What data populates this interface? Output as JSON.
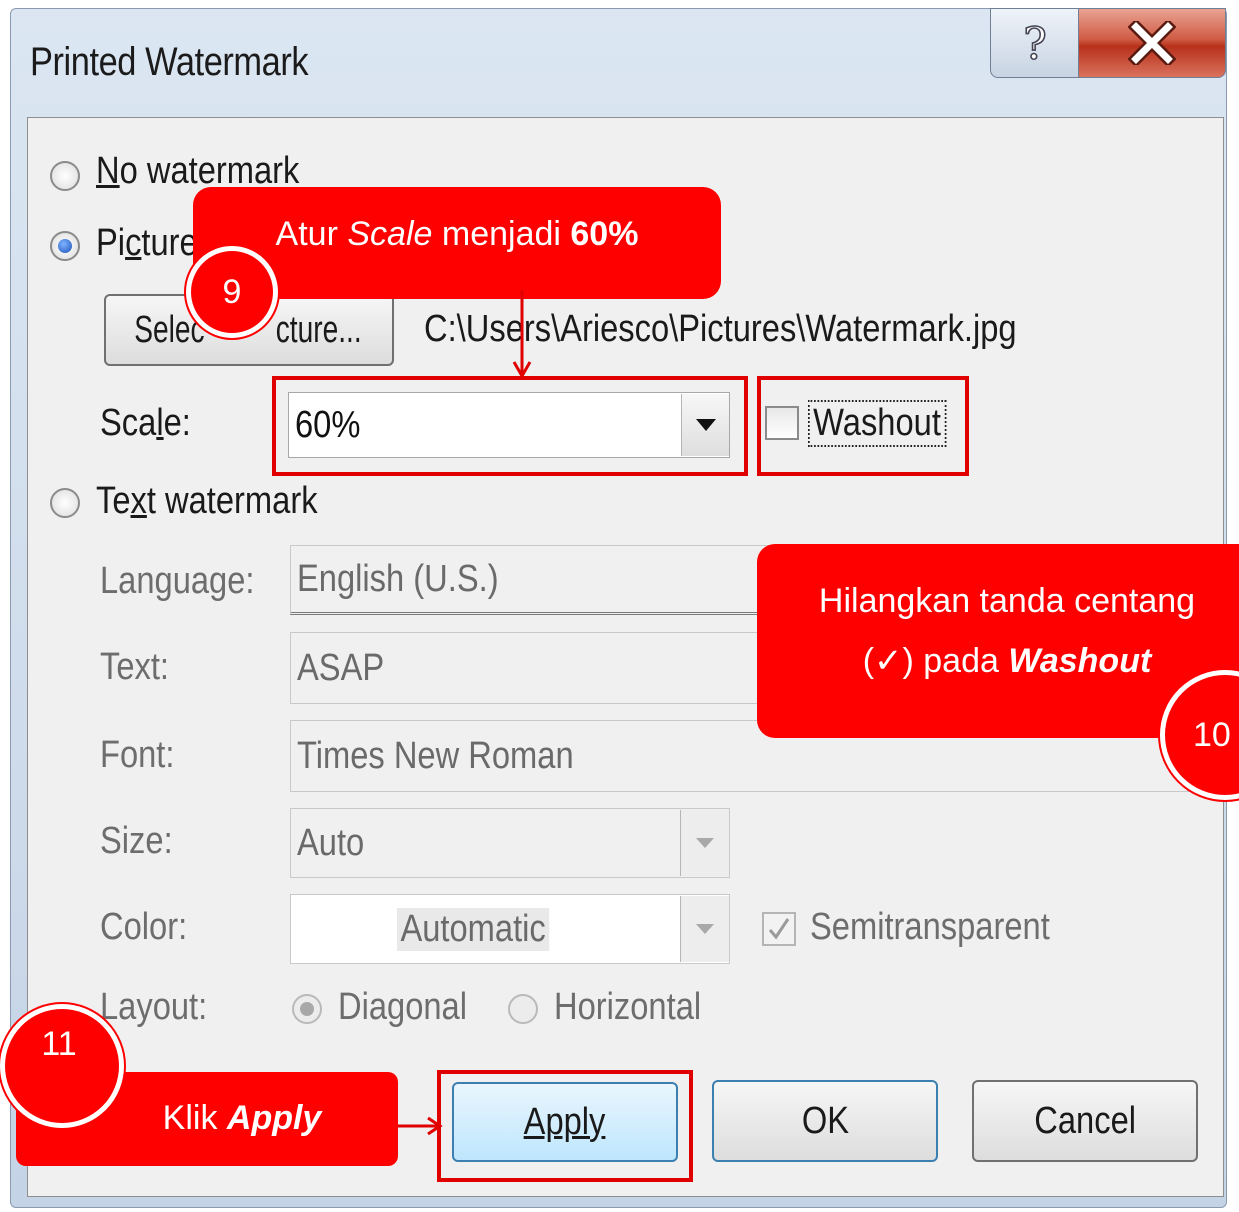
{
  "dialog": {
    "title": "Printed Watermark",
    "help_label": "?",
    "close_label": "X"
  },
  "options": {
    "no_watermark": {
      "pre": "",
      "ul": "N",
      "post": "o watermark",
      "selected": false
    },
    "picture": {
      "pre": "Pi",
      "ul": "c",
      "post": "ture watermark",
      "visible_text": "Picture",
      "selected": true
    },
    "text": {
      "pre": "Te",
      "ul": "x",
      "post": "t watermark",
      "selected": false
    }
  },
  "picture_section": {
    "select_button": "Select Picture...",
    "select_button_visible_left": "Selec",
    "select_button_visible_right": "cture...",
    "file_path": "C:\\Users\\Ariesco\\Pictures\\Watermark.jpg",
    "scale_label_pre": "Sca",
    "scale_label_ul": "l",
    "scale_label_post": "e:",
    "scale_value": "60%",
    "washout_label": "Washout",
    "washout_checked": false
  },
  "text_section": {
    "language_label": "Language:",
    "language_value": "English (U.S.)",
    "text_label": "Text:",
    "text_value": "ASAP",
    "font_label": "Font:",
    "font_value": "Times New Roman",
    "size_label": "Size:",
    "size_value": "Auto",
    "color_label": "Color:",
    "color_value": "Automatic",
    "semitransparent_label": "Semitransparent",
    "semitransparent_checked": true,
    "layout_label": "Layout:",
    "layout_diagonal": "Diagonal",
    "layout_horizontal": "Horizontal",
    "layout_selected": "Diagonal"
  },
  "buttons": {
    "apply": "Apply",
    "ok": "OK",
    "cancel": "Cancel"
  },
  "annotations": {
    "step9": {
      "number": "9",
      "text_pre": "Atur ",
      "text_em": "Scale",
      "text_mid": " menjadi ",
      "text_strong": "60%"
    },
    "step10": {
      "number": "10",
      "line1": "Hilangkan tanda centang",
      "line2_pre": "(✓) pada ",
      "line2_strong": "Washout"
    },
    "step11": {
      "number": "11",
      "text_pre": "Klik ",
      "text_strong": "Apply"
    }
  },
  "colors": {
    "annotation_red": "#ff0000",
    "close_button": "#c7432c",
    "focus_border": "#3c7fb1"
  }
}
